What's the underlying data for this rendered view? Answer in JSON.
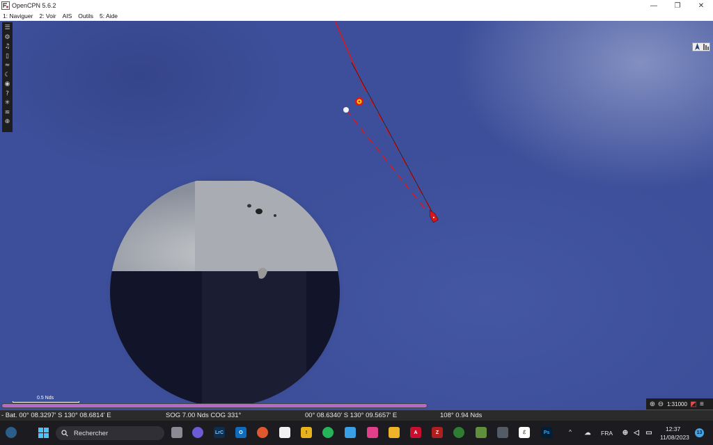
{
  "window": {
    "title": "OpenCPN 5.6.2",
    "minimize": "—",
    "maximize": "❐",
    "close": "✕"
  },
  "menu": {
    "items": [
      "1: Naviguer",
      "2: Voir",
      "AIS",
      "Outils",
      "5: Aide"
    ]
  },
  "toolbar": {
    "icons": [
      "menu-icon",
      "settings-icon",
      "route-icon",
      "document-icon",
      "tide-icon",
      "moon-icon",
      "camera-icon",
      "help-icon",
      "ais-icon",
      "grib-icon",
      "lifebuoy-icon"
    ]
  },
  "chart": {
    "scale_label": "0.5 Nds",
    "zoom_scale": "1:31000",
    "route_color": "#e01515",
    "boat_color": "#d31a1a",
    "water_color": "#3d4f9a",
    "progress_color": "#b56ac9"
  },
  "status": {
    "bat_position": "- Bat. 00° 08.3297' S    130° 08.6814' E",
    "sog_cog": "SOG 7.00 Nds   COG 331°",
    "cursor_position": "00° 08.6340' S   130° 09.5657' E",
    "bearing_distance": "108°  0.94 Nds"
  },
  "taskbar": {
    "search_placeholder": "Rechercher",
    "lang": "FRA",
    "time": "12:37",
    "date": "11/08/2023",
    "notifications": "13",
    "chevron": "^"
  }
}
